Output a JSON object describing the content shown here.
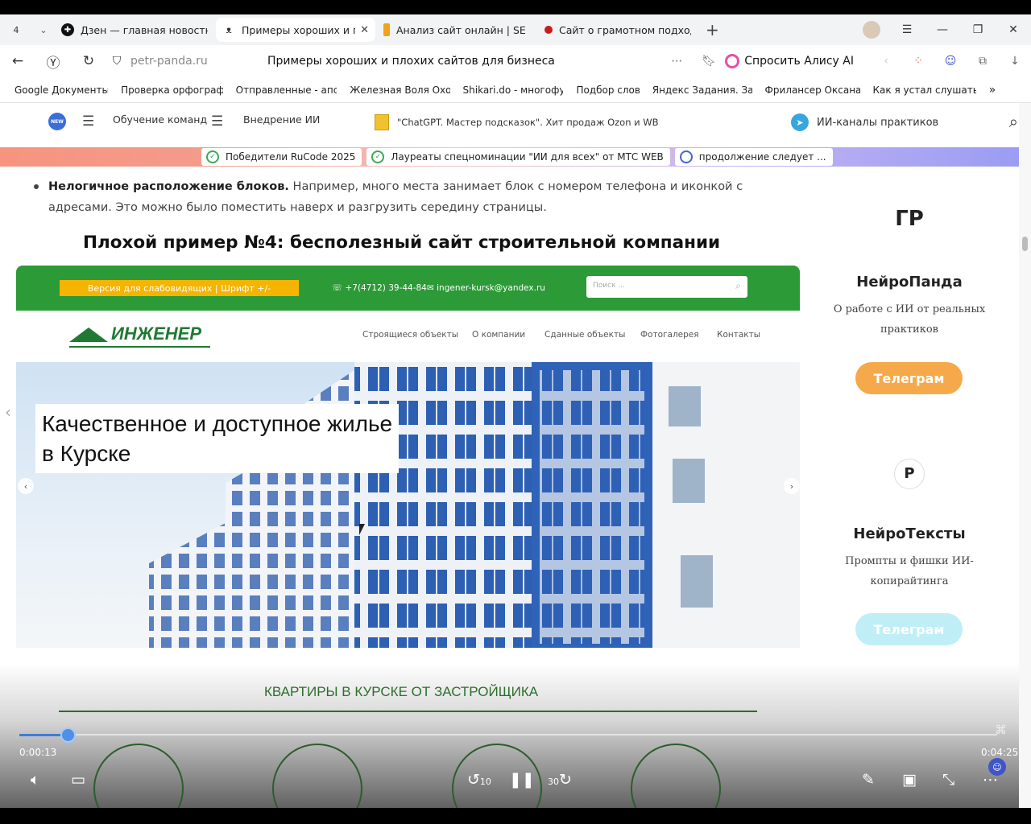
{
  "browser": {
    "tab_count": "4",
    "tabs": [
      {
        "title": "Дзен — главная новостна",
        "color": "#111111",
        "active": false
      },
      {
        "title": "Примеры хороших и п",
        "color": "#333333",
        "active": true
      },
      {
        "title": "Анализ сайт онлайн | SE",
        "color": "#f0a21b",
        "active": false
      },
      {
        "title": "Сайт о грамотном подход",
        "color": "#c81d1d",
        "active": false
      }
    ],
    "address_host": "petr-panda.ru",
    "page_title": "Примеры хороших и плохих сайтов для бизнеса",
    "alice_label": "Спросить Алису AI",
    "bookmarks": [
      "Google Документы",
      "Проверка орфограф",
      "Отправленные - апс",
      "Железная Воля Охо",
      "Shikari.do - многофу",
      "Подбор слов",
      "Яндекс Задания. За",
      "Фрилансер Оксана",
      "Как я устал слушать"
    ],
    "bookmarks_more": "»"
  },
  "site_header": {
    "new_badge": "NEW",
    "menu1": "Обучение команд",
    "menu2": "Внедрение ИИ",
    "promo": "\"ChatGPT. Мастер подсказок\". Хит продаж Ozon и WB",
    "channels": "ИИ-каналы практиков"
  },
  "ribbon": {
    "items": [
      "Победители RuCode 2025",
      "Лауреаты спецноминации \"ИИ для всех\" от МТС WEB",
      "продолжение следует ..."
    ]
  },
  "article": {
    "bullet_bold": "Нелогичное расположение блоков.",
    "bullet_text": " Например, много места занимает блок с номером телефона и иконкой с адресами. Это можно было поместить наверх и разгрузить середину страницы.",
    "heading": "Плохой пример №4: бесполезный сайт строительной компании"
  },
  "embedded": {
    "version_label": "Версия для слабовидящих | Шрифт +/-",
    "phone": "+7(4712) 39-44-84",
    "email": "ingener-kursk@yandex.ru",
    "search_placeholder": "Поиск ...",
    "logo": "ИНЖЕНЕР",
    "nav": [
      "Строящиеся объекты",
      "О компании",
      "Сданные объекты",
      "Фотогалерея",
      "Контакты"
    ],
    "hero_line1": "Качественное и доступное жилье",
    "hero_line2": "в Курске",
    "section_title": "КВАРТИРЫ В КУРСКЕ ОТ ЗАСТРОЙЩИКА"
  },
  "sidebar": {
    "card1": {
      "title": "НейроПанда",
      "desc": "О работе с ИИ от реальных практиков",
      "button": "Телеграм",
      "color": "#f6a94a"
    },
    "card2": {
      "title": "НейроТексты",
      "desc": "Промпты и фишки ИИ-копирайтинга",
      "button": "Телеграм",
      "color": "#bfeef7"
    }
  },
  "player": {
    "current_time": "0:00:13",
    "total_time": "0:04:25",
    "progress": 0.05,
    "skip_back": "10",
    "skip_forward": "30"
  },
  "colors": {
    "accent": "#3d7ed8",
    "green": "#2c9a36"
  }
}
